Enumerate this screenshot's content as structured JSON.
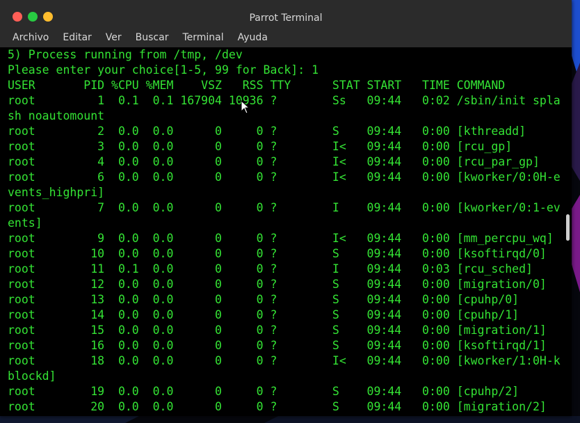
{
  "window": {
    "title": "Parrot Terminal"
  },
  "menubar": {
    "items": [
      "Archivo",
      "Editar",
      "Ver",
      "Buscar",
      "Terminal",
      "Ayuda"
    ]
  },
  "terminal": {
    "lines": [
      "5) Process running from /tmp, /dev",
      "Please enter your choice[1-5, 99 for Back]: 1",
      "USER       PID %CPU %MEM    VSZ   RSS TTY      STAT START   TIME COMMAND",
      "root         1  0.1  0.1 167904 10936 ?        Ss   09:44   0:02 /sbin/init spla",
      "sh noautomount",
      "root         2  0.0  0.0      0     0 ?        S    09:44   0:00 [kthreadd]",
      "root         3  0.0  0.0      0     0 ?        I<   09:44   0:00 [rcu_gp]",
      "root         4  0.0  0.0      0     0 ?        I<   09:44   0:00 [rcu_par_gp]",
      "root         6  0.0  0.0      0     0 ?        I<   09:44   0:00 [kworker/0:0H-e",
      "vents_highpri]",
      "root         7  0.0  0.0      0     0 ?        I    09:44   0:00 [kworker/0:1-ev",
      "ents]",
      "root         9  0.0  0.0      0     0 ?        I<   09:44   0:00 [mm_percpu_wq]",
      "root        10  0.0  0.0      0     0 ?        S    09:44   0:00 [ksoftirqd/0]",
      "root        11  0.1  0.0      0     0 ?        I    09:44   0:03 [rcu_sched]",
      "root        12  0.0  0.0      0     0 ?        S    09:44   0:00 [migration/0]",
      "root        13  0.0  0.0      0     0 ?        S    09:44   0:00 [cpuhp/0]",
      "root        14  0.0  0.0      0     0 ?        S    09:44   0:00 [cpuhp/1]",
      "root        15  0.0  0.0      0     0 ?        S    09:44   0:00 [migration/1]",
      "root        16  0.0  0.0      0     0 ?        S    09:44   0:00 [ksoftirqd/1]",
      "root        18  0.0  0.0      0     0 ?        I<   09:44   0:00 [kworker/1:0H-k",
      "blockd]",
      "root        19  0.0  0.0      0     0 ?        S    09:44   0:00 [cpuhp/2]",
      "root        20  0.0  0.0      0     0 ?        S    09:44   0:00 [migration/2]"
    ]
  },
  "colors": {
    "terminal_text": "#34e334",
    "terminal_bg": "#000000",
    "titlebar_bg": "#2b2b2b",
    "close": "#ff5f57",
    "minimize": "#28ca42",
    "maximize": "#ffbd2e"
  }
}
